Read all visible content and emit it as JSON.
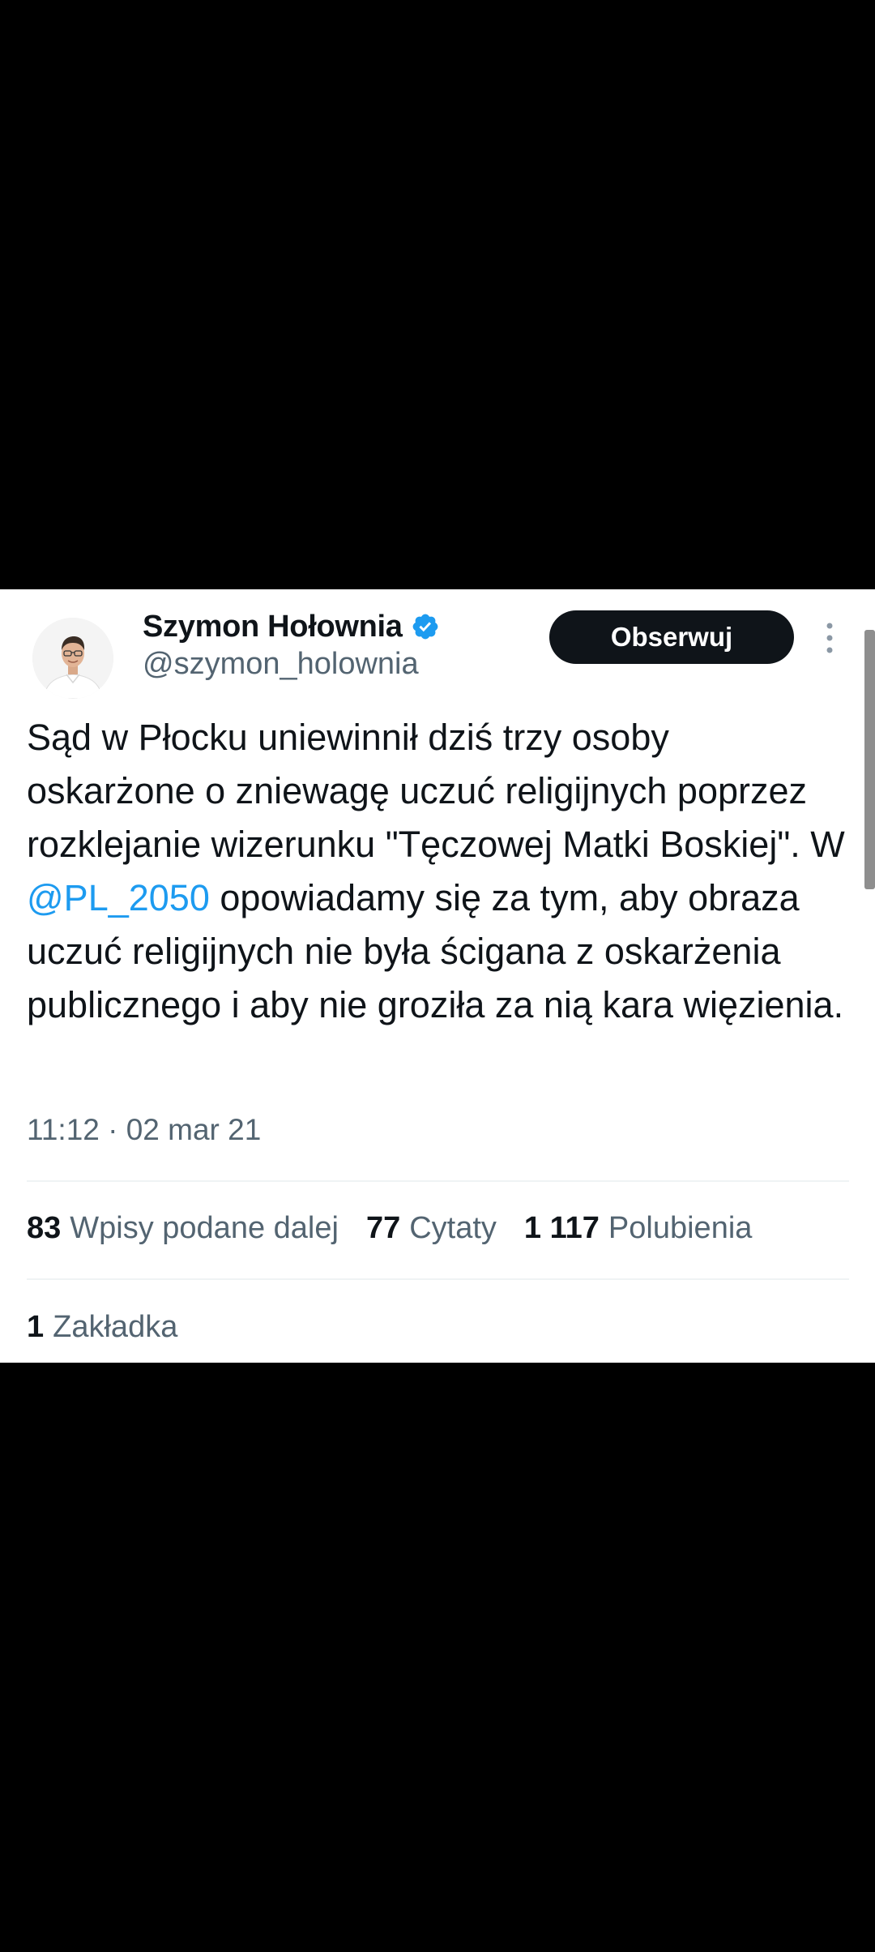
{
  "author": {
    "name": "Szymon Hołownia",
    "handle": "@szymon_holownia",
    "verified_icon": "verified-badge-icon",
    "avatar_icon": "profile-photo-avatar"
  },
  "follow_button": {
    "label": "Obserwuj"
  },
  "more_icon": "more-vertical-icon",
  "tweet": {
    "text_before_mention": "Sąd w Płocku uniewinnił dziś trzy osoby oskarżone o zniewagę uczuć religijnych poprzez rozklejanie wizerunku \"Tęczowej Matki Boskiej\". W ",
    "mention": "@PL_2050",
    "text_after_mention": " opowiadamy się za tym, aby obraza uczuć religijnych nie była ścigana z oskarżenia publicznego i aby nie groziła za nią kara więzienia.",
    "timestamp": "11:12 · 02 mar 21"
  },
  "stats": {
    "reposts": {
      "count": "83",
      "label": "Wpisy podane dalej"
    },
    "quotes": {
      "count": "77",
      "label": "Cytaty"
    },
    "likes": {
      "count": "1 117",
      "label": "Polubienia"
    },
    "bookmarks": {
      "count": "1",
      "label": "Zakładka"
    }
  },
  "colors": {
    "text": "#0f1419",
    "secondary_text": "#536471",
    "link": "#1d9bf0",
    "verified": "#1d9bf0",
    "button_bg": "#0f1419",
    "background_outside": "#000000",
    "divider": "#eff3f4"
  }
}
